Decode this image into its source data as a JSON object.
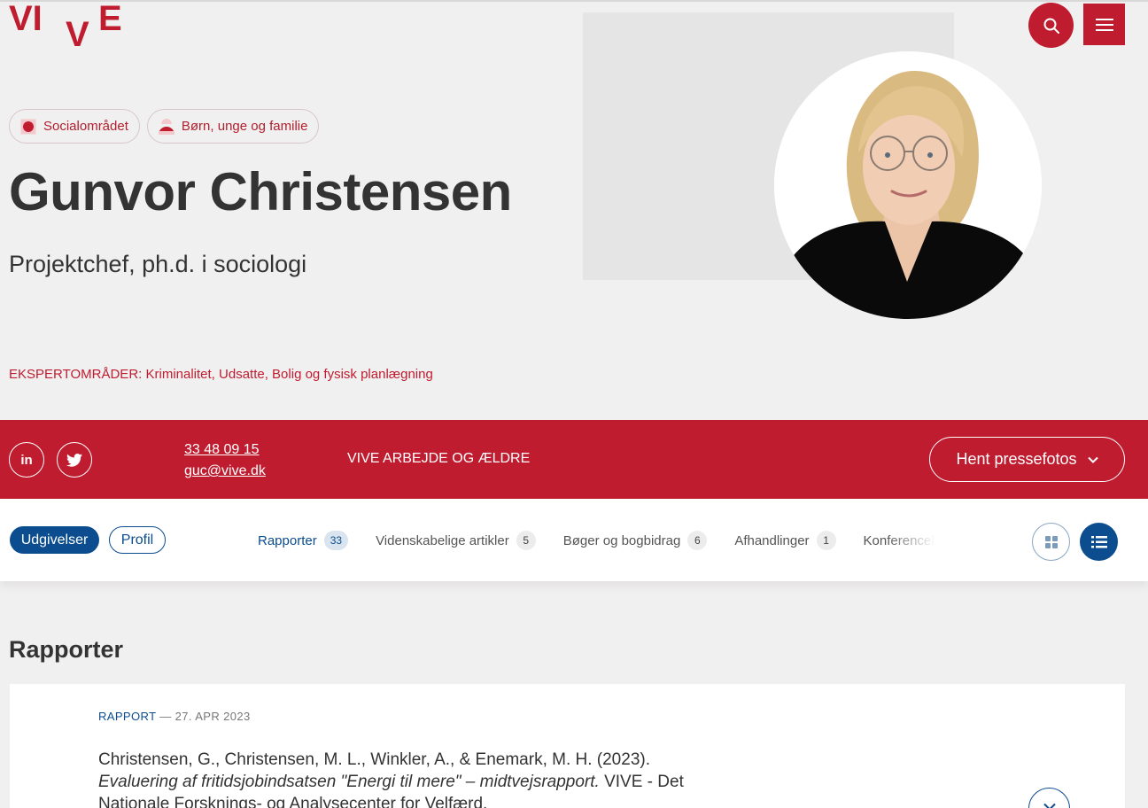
{
  "brand": {
    "logo_text": "VIVE",
    "accent_color": "#c01c30",
    "blue_color": "#0b4d8e"
  },
  "header": {
    "search_icon": "search-icon",
    "menu_icon": "hamburger-icon"
  },
  "profile": {
    "tags": [
      {
        "label": "Socialområdet",
        "icon": "square-dot-icon"
      },
      {
        "label": "Børn, unge og familie",
        "icon": "half-circle-icon"
      }
    ],
    "name": "Gunvor Christensen",
    "title": "Projektchef, ph.d. i sociologi",
    "expertise_label": "EKSPERTOMRÅDER:",
    "expertise_values": "Kriminalitet, Udsatte, Bolig og fysisk planlægning",
    "portrait_icon": "portrait-photo"
  },
  "contact_bar": {
    "phone": "33 48 09 15",
    "email": "guc@vive.dk",
    "department": "VIVE ARBEJDE OG ÆLDRE",
    "press_button": "Hent pressefotos",
    "linkedin_label": "in",
    "twitter_icon": "twitter-icon"
  },
  "tabs": {
    "main": [
      {
        "label": "Udgivelser",
        "active": true
      },
      {
        "label": "Profil",
        "active": false
      }
    ],
    "publications": [
      {
        "label": "Rapporter",
        "count": "33",
        "active": true
      },
      {
        "label": "Videnskabelige artikler",
        "count": "5",
        "active": false
      },
      {
        "label": "Bøger og bogbidrag",
        "count": "6",
        "active": false
      },
      {
        "label": "Afhandlinger",
        "count": "1",
        "active": false
      },
      {
        "label": "Konferencebidrag",
        "count": "",
        "active": false
      }
    ],
    "view_modes": [
      "grid-view-icon",
      "list-view-icon"
    ]
  },
  "content": {
    "section_title": "Rapporter",
    "items": [
      {
        "type": "RAPPORT",
        "separator": "—",
        "date": "27. APR 2023",
        "authors": "Christensen, G., Christensen, M. L., Winkler, A., & Enemark, M. H. (2023).",
        "title_italic": "Evaluering af fritidsjobindsatsen \"Energi til mere\" – midtvejsrap­port.",
        "publisher": "VIVE - Det Nationale Forsknings- og Analysecenter for Velfærd.",
        "expand_icon": "chevron-down-icon"
      }
    ]
  }
}
